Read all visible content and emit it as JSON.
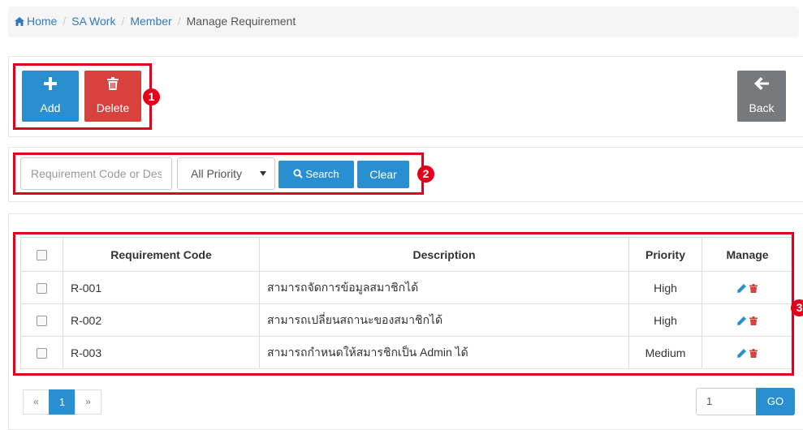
{
  "breadcrumb": {
    "home": "Home",
    "items": [
      "SA Work",
      "Member"
    ],
    "current": "Manage Requirement",
    "separator": "/"
  },
  "toolbar": {
    "add_label": "Add",
    "delete_label": "Delete",
    "back_label": "Back",
    "badge": "1"
  },
  "search": {
    "placeholder": "Requirement Code or Description",
    "priority_value": "All Priority",
    "search_label": "Search",
    "clear_label": "Clear",
    "badge": "2"
  },
  "table": {
    "badge": "3",
    "headers": [
      "Requirement Code",
      "Description",
      "Priority",
      "Manage"
    ],
    "rows": [
      {
        "code": "R-001",
        "description": "สามารถจัดการข้อมูลสมาชิกได้",
        "priority": "High"
      },
      {
        "code": "R-002",
        "description": "สามารถเปลี่ยนสถานะของสมาชิกได้",
        "priority": "High"
      },
      {
        "code": "R-003",
        "description": "สามารถกำหนดให้สมารชิกเป็น Admin ได้",
        "priority": "Medium"
      }
    ]
  },
  "pagination": {
    "prev": "«",
    "current": "1",
    "next": "»",
    "goto_value": "1",
    "go_label": "GO"
  },
  "colors": {
    "primary": "#2a8fd1",
    "danger": "#d9413f",
    "back": "#777a7d",
    "annotation": "#e2001a"
  }
}
